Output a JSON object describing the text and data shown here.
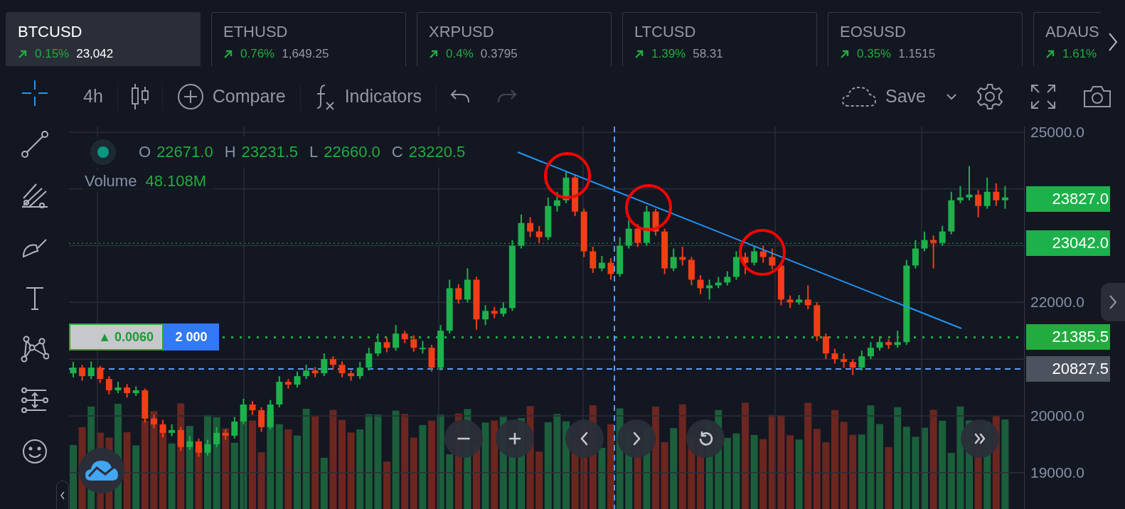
{
  "tickers": [
    {
      "symbol": "BTCUSD",
      "change": "0.15%",
      "price": "23,042",
      "selected": true
    },
    {
      "symbol": "ETHUSD",
      "change": "0.76%",
      "price": "1,649.25",
      "selected": false
    },
    {
      "symbol": "XRPUSD",
      "change": "0.4%",
      "price": "0.3795",
      "selected": false
    },
    {
      "symbol": "LTCUSD",
      "change": "1.39%",
      "price": "58.31",
      "selected": false
    },
    {
      "symbol": "EOSUSD",
      "change": "0.35%",
      "price": "1.1515",
      "selected": false
    },
    {
      "symbol": "ADAUS",
      "change": "1.61%",
      "selected": false
    }
  ],
  "toolbar": {
    "interval": "4h",
    "compare": "Compare",
    "indicators": "Indicators",
    "undo": {
      "disabled": false
    },
    "redo": {
      "disabled": true
    },
    "save": "Save"
  },
  "drawing_tools": [
    {
      "kind": "crosshair",
      "selected": true
    },
    {
      "kind": "trend_line",
      "selected": false
    },
    {
      "kind": "fib",
      "selected": false
    },
    {
      "kind": "brush",
      "selected": false
    },
    {
      "kind": "text",
      "selected": false
    },
    {
      "kind": "pattern",
      "selected": false
    },
    {
      "kind": "measure",
      "selected": false
    },
    {
      "kind": "emoji",
      "selected": false
    }
  ],
  "legend": {
    "ohlc": [
      {
        "label": "O",
        "value": "22671.0"
      },
      {
        "label": "H",
        "value": "23231.5"
      },
      {
        "label": "L",
        "value": "22660.0"
      },
      {
        "label": "C",
        "value": "23220.5"
      }
    ],
    "volume_label": "Volume",
    "volume_value": "48.108M"
  },
  "order": {
    "change": "▲ 0.0060",
    "quantity": "2 000"
  },
  "chart": {
    "chart_data": {
      "type": "candlestick",
      "grid": true,
      "ylim": [
        18358,
        25100
      ],
      "yticks": [
        {
          "value": 25000,
          "label": "25000.0"
        },
        {
          "value": 22000,
          "label": "22000.0"
        },
        {
          "value": 20000,
          "label": "20000.0"
        },
        {
          "value": 19000,
          "label": "19000.0"
        }
      ],
      "ohlc": [
        [
          20750,
          20950,
          20680,
          20850
        ],
        [
          20850,
          20900,
          20620,
          20700
        ],
        [
          20700,
          20960,
          20650,
          20850
        ],
        [
          20850,
          20880,
          20580,
          20650
        ],
        [
          20650,
          20700,
          20380,
          20450
        ],
        [
          20450,
          20600,
          20400,
          20500
        ],
        [
          20500,
          20560,
          20320,
          20400
        ],
        [
          20400,
          20520,
          20350,
          20450
        ],
        [
          20450,
          20480,
          19880,
          19950
        ],
        [
          19950,
          20020,
          19780,
          19850
        ],
        [
          19850,
          19930,
          19620,
          19700
        ],
        [
          19700,
          19850,
          19640,
          19750
        ],
        [
          19750,
          19800,
          19380,
          19450
        ],
        [
          19450,
          19640,
          19400,
          19550
        ],
        [
          19550,
          19600,
          19280,
          19350
        ],
        [
          19350,
          19580,
          19300,
          19500
        ],
        [
          19500,
          19800,
          19450,
          19700
        ],
        [
          19700,
          19760,
          19580,
          19650
        ],
        [
          19650,
          19980,
          19600,
          19900
        ],
        [
          19900,
          20300,
          19850,
          20200
        ],
        [
          20200,
          20260,
          20020,
          20100
        ],
        [
          20100,
          20150,
          19720,
          19800
        ],
        [
          19800,
          20280,
          19760,
          20200
        ],
        [
          20200,
          20700,
          20150,
          20600
        ],
        [
          20600,
          20650,
          20480,
          20550
        ],
        [
          20550,
          20780,
          20500,
          20700
        ],
        [
          20700,
          20900,
          20650,
          20800
        ],
        [
          20800,
          20860,
          20680,
          20750
        ],
        [
          20750,
          21100,
          20700,
          21000
        ],
        [
          21000,
          21050,
          20820,
          20900
        ],
        [
          20900,
          20960,
          20680,
          20750
        ],
        [
          20750,
          20800,
          20620,
          20700
        ],
        [
          20700,
          20950,
          20650,
          20850
        ],
        [
          20850,
          21200,
          20800,
          21100
        ],
        [
          21100,
          21450,
          21050,
          21300
        ],
        [
          21300,
          21380,
          21120,
          21200
        ],
        [
          21200,
          21600,
          21150,
          21450
        ],
        [
          21450,
          21500,
          21280,
          21350
        ],
        [
          21350,
          21420,
          21130,
          21200
        ],
        [
          21200,
          21320,
          21100,
          21200
        ],
        [
          21200,
          21250,
          20780,
          20850
        ],
        [
          20850,
          21600,
          20800,
          21500
        ],
        [
          21500,
          22400,
          21450,
          22250
        ],
        [
          22250,
          22320,
          21980,
          22050
        ],
        [
          22050,
          22600,
          22000,
          22400
        ],
        [
          22400,
          22450,
          21520,
          21700
        ],
        [
          21700,
          21950,
          21600,
          21850
        ],
        [
          21850,
          21920,
          21720,
          21800
        ],
        [
          21800,
          22000,
          21750,
          21900
        ],
        [
          21900,
          23100,
          21850,
          23000
        ],
        [
          23000,
          23550,
          22950,
          23400
        ],
        [
          23400,
          23500,
          23150,
          23250
        ],
        [
          23250,
          23350,
          23050,
          23150
        ],
        [
          23150,
          23850,
          23100,
          23700
        ],
        [
          23700,
          23950,
          23600,
          23800
        ],
        [
          23800,
          24300,
          23750,
          24200
        ],
        [
          24200,
          24250,
          23520,
          23600
        ],
        [
          23600,
          23650,
          22800,
          22900
        ],
        [
          22900,
          22980,
          22520,
          22600
        ],
        [
          22600,
          22820,
          22550,
          22700
        ],
        [
          22700,
          22780,
          22400,
          22500
        ],
        [
          22500,
          23150,
          22450,
          23000
        ],
        [
          23000,
          23450,
          22950,
          23300
        ],
        [
          23300,
          23380,
          22980,
          23050
        ],
        [
          23050,
          23700,
          23000,
          23600
        ],
        [
          23600,
          23650,
          23180,
          23250
        ],
        [
          23250,
          23300,
          22500,
          22600
        ],
        [
          22600,
          22950,
          22550,
          22800
        ],
        [
          22800,
          22980,
          22650,
          22750
        ],
        [
          22750,
          22800,
          22300,
          22400
        ],
        [
          22400,
          22480,
          22150,
          22250
        ],
        [
          22250,
          22400,
          22050,
          22300
        ],
        [
          22300,
          22450,
          22250,
          22350
        ],
        [
          22350,
          22550,
          22300,
          22450
        ],
        [
          22450,
          22900,
          22400,
          22800
        ],
        [
          22800,
          22880,
          22500,
          22700
        ],
        [
          22700,
          23000,
          22650,
          22900
        ],
        [
          22900,
          23000,
          22700,
          22800
        ],
        [
          22800,
          22950,
          22580,
          22650
        ],
        [
          22650,
          22700,
          21950,
          22050
        ],
        [
          22050,
          22120,
          21900,
          22000
        ],
        [
          22000,
          22130,
          21960,
          22050
        ],
        [
          22050,
          22300,
          21880,
          21950
        ],
        [
          21950,
          22000,
          21320,
          21400
        ],
        [
          21400,
          21450,
          21000,
          21100
        ],
        [
          21100,
          21180,
          20920,
          21000
        ],
        [
          21000,
          21100,
          20850,
          20950
        ],
        [
          20950,
          21000,
          20720,
          20850
        ],
        [
          20850,
          21150,
          20800,
          21050
        ],
        [
          21050,
          21300,
          21000,
          21200
        ],
        [
          21200,
          21400,
          21150,
          21300
        ],
        [
          21300,
          21350,
          21180,
          21250
        ],
        [
          21250,
          21500,
          21200,
          21300
        ],
        [
          21300,
          22750,
          21250,
          22650
        ],
        [
          22650,
          23100,
          22600,
          22950
        ],
        [
          22950,
          23250,
          22900,
          23100
        ],
        [
          23100,
          23180,
          22600,
          23050
        ],
        [
          23050,
          23350,
          23000,
          23250
        ],
        [
          23250,
          23950,
          23200,
          23800
        ],
        [
          23800,
          24050,
          23750,
          23850
        ],
        [
          23850,
          24400,
          23800,
          23900
        ],
        [
          23900,
          23980,
          23500,
          23700
        ],
        [
          23700,
          24200,
          23650,
          23950
        ],
        [
          23950,
          24100,
          23700,
          23800
        ],
        [
          23800,
          24050,
          23650,
          23850
        ]
      ]
    },
    "markers": [
      {
        "price": "23827.0",
        "kind": "last"
      },
      {
        "price": "23042.0",
        "kind": "level"
      },
      {
        "price": "21385.5",
        "kind": "order"
      },
      {
        "price": "20827.5",
        "kind": "crosshair"
      }
    ]
  }
}
